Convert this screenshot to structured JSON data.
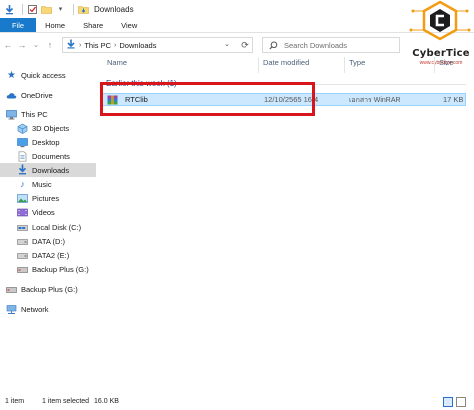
{
  "window": {
    "title": "Downloads"
  },
  "ribbon": {
    "tabs": [
      "File",
      "Home",
      "Share",
      "View"
    ]
  },
  "address": {
    "crumbs": [
      "This PC",
      "Downloads"
    ]
  },
  "search": {
    "placeholder": "Search Downloads"
  },
  "sidebar": {
    "items": [
      {
        "label": "Quick access",
        "icon": "star-icon"
      },
      {
        "label": "OneDrive",
        "icon": "cloud-icon"
      },
      {
        "label": "This PC",
        "icon": "pc-icon"
      },
      {
        "label": "3D Objects",
        "icon": "cube-icon"
      },
      {
        "label": "Desktop",
        "icon": "desktop-icon"
      },
      {
        "label": "Documents",
        "icon": "documents-icon"
      },
      {
        "label": "Downloads",
        "icon": "download-icon",
        "selected": true
      },
      {
        "label": "Music",
        "icon": "music-icon"
      },
      {
        "label": "Pictures",
        "icon": "pictures-icon"
      },
      {
        "label": "Videos",
        "icon": "videos-icon"
      },
      {
        "label": "Local Disk (C:)",
        "icon": "drive-icon"
      },
      {
        "label": "DATA (D:)",
        "icon": "drive-icon"
      },
      {
        "label": "DATA2 (E:)",
        "icon": "drive-icon"
      },
      {
        "label": "Backup Plus (G:)",
        "icon": "external-drive-icon"
      },
      {
        "label": "Backup Plus (G:)",
        "icon": "external-drive-icon"
      },
      {
        "label": "Network",
        "icon": "network-icon"
      }
    ]
  },
  "columns": {
    "name": "Name",
    "date": "Date modified",
    "type": "Type",
    "size": "Size"
  },
  "group": {
    "label": "Earlier this week (1)"
  },
  "files": [
    {
      "name": "RTClib",
      "date": "12/10/2565 16:4",
      "type": "เอกสาร WinRAR",
      "size": "17 KB",
      "icon": "winrar-archive-icon"
    }
  ],
  "status": {
    "count": "1 item",
    "selected": "1 item selected",
    "size": "16.0 KB"
  },
  "logo": {
    "name": "CyberTice",
    "url": "www.cybertice.com"
  },
  "colors": {
    "accent": "#1979ca",
    "selection": "#cce8ff",
    "highlight_box": "#d7151b",
    "logo_orange": "#f39c12"
  }
}
